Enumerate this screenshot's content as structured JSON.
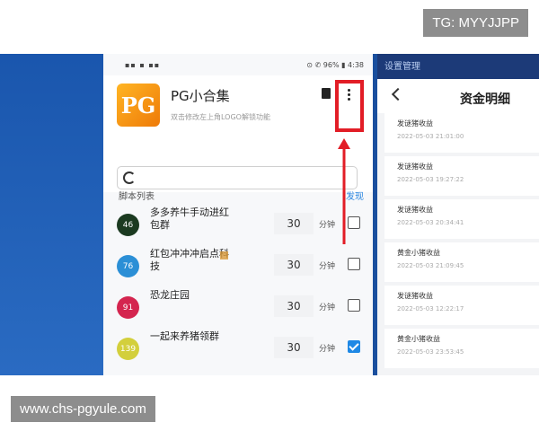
{
  "watermark": "TG: MYYJJPP",
  "footer_url": "www.chs-pgyule.com",
  "colors": {
    "accent_red": "#e21d26",
    "blue": "#1e88e5",
    "link": "#2a86e0"
  },
  "status_bar": {
    "left": "▪▪ ▪ ▪▪",
    "right": "⊙ ✆ 96% ▮ 4:38"
  },
  "app": {
    "logo": "PG",
    "title": "PG小合集",
    "subtitle": "双击修改左上角LOGO解锁功能",
    "search_placeholder": ""
  },
  "section": {
    "title": "脚本列表",
    "action": "发现"
  },
  "scripts": [
    {
      "badge": "46",
      "color": "#1b3a20",
      "name": "多多养牛手动进红包群",
      "value": "30",
      "unit": "分钟",
      "checked": false,
      "tag": false
    },
    {
      "badge": "76",
      "color": "#2b8fd6",
      "name": "红包冲冲冲启点科技",
      "value": "30",
      "unit": "分钟",
      "checked": false,
      "tag": true
    },
    {
      "badge": "91",
      "color": "#d4254f",
      "name": "恐龙庄园",
      "value": "30",
      "unit": "分钟",
      "checked": false,
      "tag": false
    },
    {
      "badge": "139",
      "color": "#d3cf3c",
      "name": "一起来养猪领群",
      "value": "30",
      "unit": "分钟",
      "checked": true,
      "tag": false
    }
  ],
  "right_panel": {
    "top_banner": "设置管理",
    "title": "资金明细",
    "entries": [
      {
        "name": "发谜猪收益",
        "date": "2022-05-03 21:01:00"
      },
      {
        "name": "发谜猪收益",
        "date": "2022-05-03 19:27:22"
      },
      {
        "name": "发谜猪收益",
        "date": "2022-05-03 20:34:41"
      },
      {
        "name": "黄金小猪收益",
        "date": "2022-05-03 21:09:45"
      },
      {
        "name": "发谜猪收益",
        "date": "2022-05-03 12:22:17"
      },
      {
        "name": "黄金小猪收益",
        "date": "2022-05-03 23:53:45"
      }
    ]
  }
}
